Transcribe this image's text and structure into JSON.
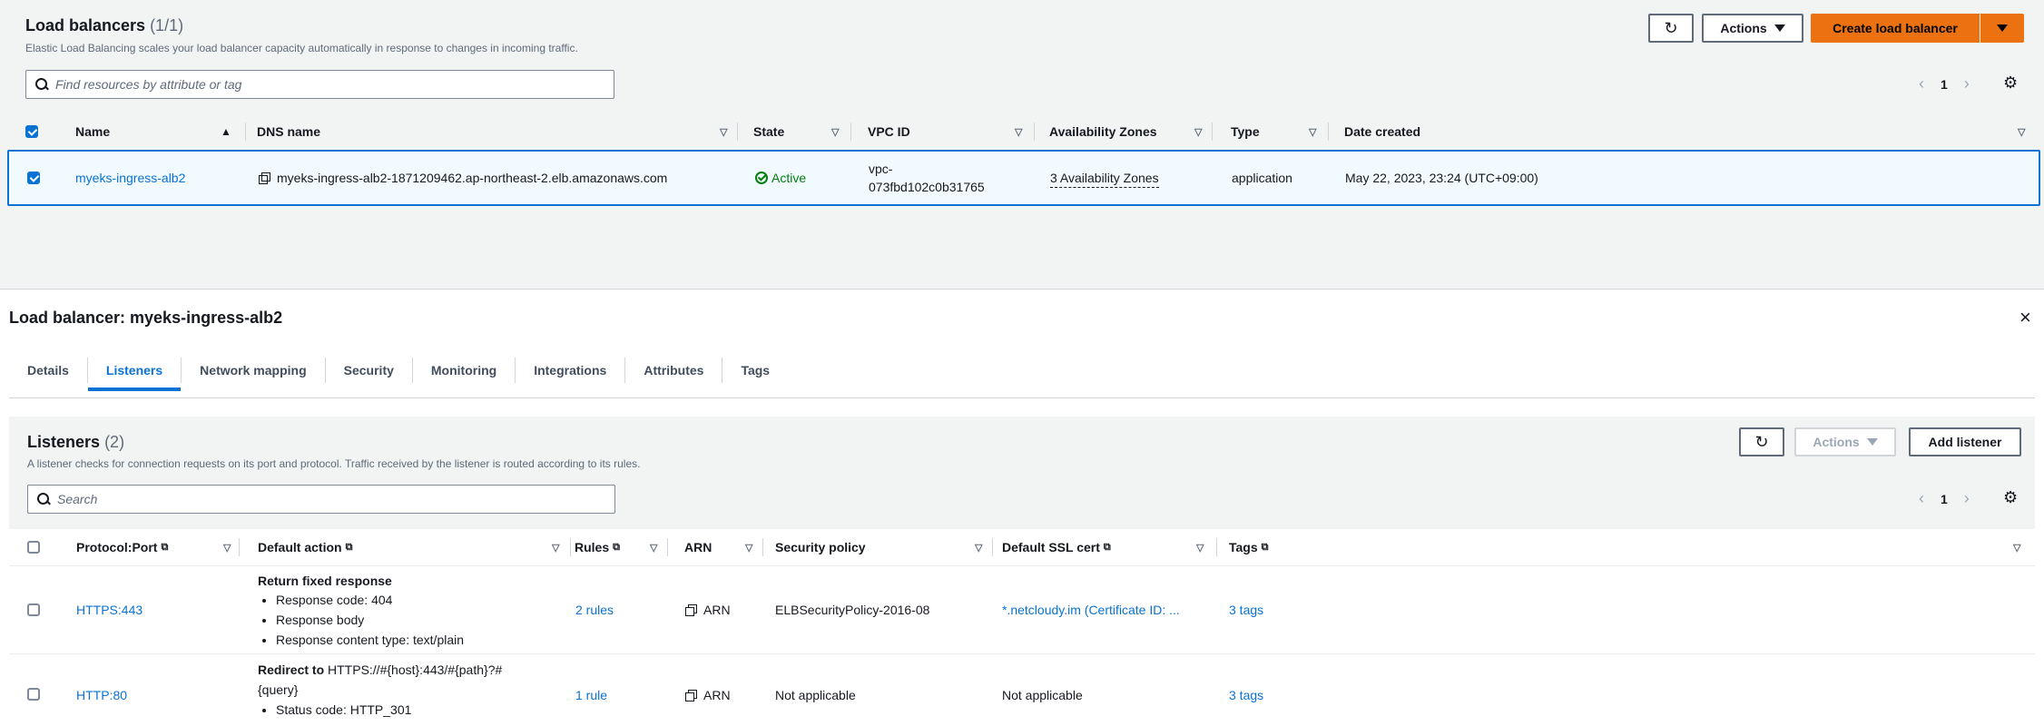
{
  "load_balancers": {
    "title": "Load balancers",
    "count": "(1/1)",
    "subtitle": "Elastic Load Balancing scales your load balancer capacity automatically in response to changes in incoming traffic.",
    "actions_label": "Actions",
    "create_label": "Create load balancer",
    "search_placeholder": "Find resources by attribute or tag",
    "page": "1",
    "columns": {
      "name": "Name",
      "dns": "DNS name",
      "state": "State",
      "vpc": "VPC ID",
      "az": "Availability Zones",
      "type": "Type",
      "date": "Date created"
    },
    "row": {
      "name": "myeks-ingress-alb2",
      "dns": "myeks-ingress-alb2-1871209462.ap-northeast-2.elb.amazonaws.com",
      "state": "Active",
      "vpc_line1": "vpc-",
      "vpc_line2": "073fbd102c0b31765",
      "az": "3 Availability Zones",
      "type": "application",
      "date": "May 22, 2023, 23:24 (UTC+09:00)"
    }
  },
  "detail": {
    "title": "Load balancer: myeks-ingress-alb2",
    "close": "×",
    "tabs": [
      "Details",
      "Listeners",
      "Network mapping",
      "Security",
      "Monitoring",
      "Integrations",
      "Attributes",
      "Tags"
    ]
  },
  "listeners": {
    "title": "Listeners",
    "count": "(2)",
    "subtitle": "A listener checks for connection requests on its port and protocol. Traffic received by the listener is routed according to its rules.",
    "actions_label": "Actions",
    "add_label": "Add listener",
    "search_placeholder": "Search",
    "page": "1",
    "columns": {
      "protocol": "Protocol:Port",
      "default_action": "Default action",
      "rules": "Rules",
      "arn": "ARN",
      "security_policy": "Security policy",
      "ssl_cert": "Default SSL cert",
      "tags": "Tags"
    },
    "rows": [
      {
        "protocol": "HTTPS:443",
        "action_title": "Return fixed response",
        "action_items": [
          "Response code: 404",
          "Response body",
          "Response content type: text/plain"
        ],
        "rules": "2 rules",
        "arn": "ARN",
        "security_policy": "ELBSecurityPolicy-2016-08",
        "ssl_cert": "*.netcloudy.im (Certificate ID: ...",
        "tags": "3 tags"
      },
      {
        "protocol": "HTTP:80",
        "action_title": "Redirect to",
        "action_target_1": "HTTPS://#{host}:443/#{path}?#",
        "action_target_2": "{query}",
        "action_items": [
          "Status code: HTTP_301"
        ],
        "rules": "1 rule",
        "arn": "ARN",
        "security_policy": "Not applicable",
        "ssl_cert": "Not applicable",
        "tags": "3 tags"
      }
    ]
  },
  "icons": {
    "refresh": "refresh-icon",
    "caret": "caret-down-icon",
    "search": "search-icon",
    "settings": "gear-icon",
    "copy": "copy-icon",
    "external": "external-link-icon",
    "status": "status-success-icon"
  },
  "colors": {
    "primary": "#ec7211",
    "link": "#0972d3",
    "success": "#037f0c",
    "selected_row_bg": "#f1faff"
  }
}
